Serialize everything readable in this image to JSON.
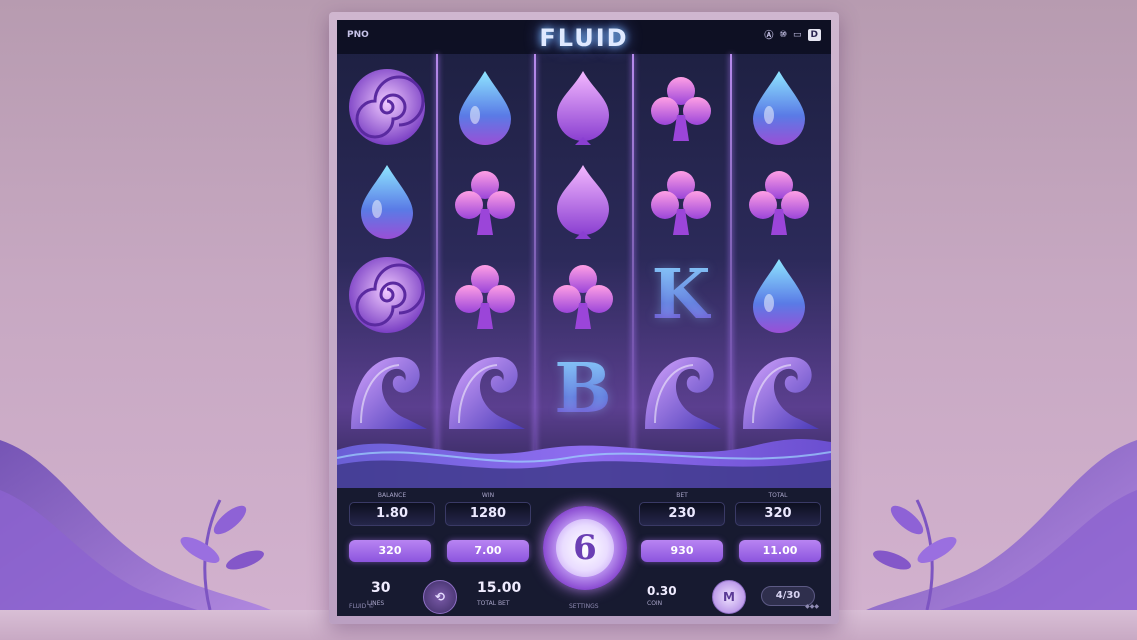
{
  "game": {
    "title": "FLUID",
    "brand_label": "PNO",
    "top_icons": [
      "icon-a",
      "icon-b",
      "icon-c"
    ],
    "top_icon_texts": [
      "Ⓐ",
      "⑩",
      "▭",
      "D"
    ]
  },
  "reels": {
    "columns": 5,
    "rows": 4,
    "grid": [
      [
        "swirl",
        "drop",
        "drop-purple",
        "club",
        "drop"
      ],
      [
        "drop",
        "club",
        "drop-purple",
        "club",
        "club"
      ],
      [
        "swirl",
        "club",
        "club",
        "K",
        "drop"
      ],
      [
        "wave",
        "wave",
        "B",
        "wave",
        "wave"
      ]
    ],
    "letters": {
      "K": "K",
      "B": "B"
    }
  },
  "panel": {
    "info_boxes": [
      {
        "label": "BALANCE",
        "value": "1.80"
      },
      {
        "label": "WIN",
        "value": "1280"
      },
      {
        "label": "BET",
        "value": "230"
      },
      {
        "label": "TOTAL",
        "value": "320"
      }
    ],
    "pills": [
      "320",
      "7.00",
      "930",
      "11.00"
    ],
    "spin_symbol": "6",
    "left_stat": "30",
    "left_stat_label": "LINES",
    "center_stat": "15.00",
    "center_stat_label": "TOTAL BET",
    "right_stat": "0.30",
    "right_stat_label": "COIN",
    "auto_button_label": "⟲",
    "max_button_label": "M",
    "capsule_label": "4/30",
    "footer_left": "FLUID ©",
    "footer_center": "SETTINGS",
    "footer_right": "◆◆◆"
  },
  "colors": {
    "accent": "#a46be8",
    "screen_dark": "#1c1f3f",
    "glow": "#7cc7ff"
  }
}
